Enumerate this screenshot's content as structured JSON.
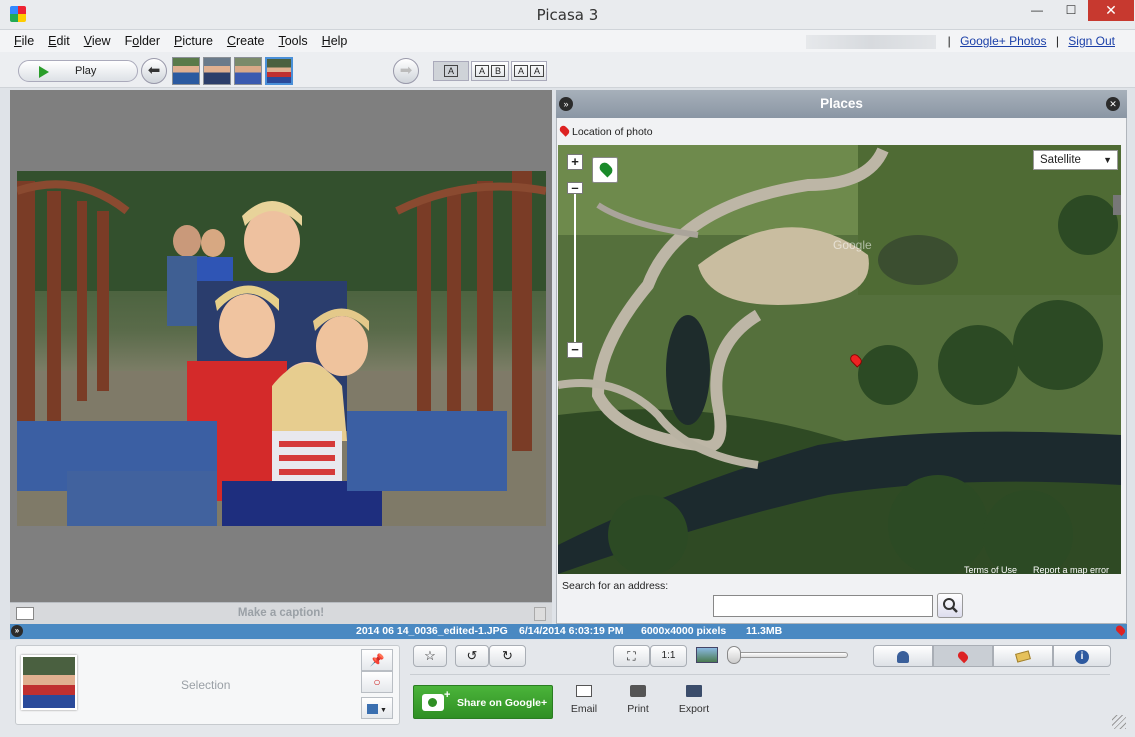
{
  "window": {
    "title": "Picasa 3",
    "min_glyph": "—",
    "max_glyph": "☐",
    "close_glyph": "✕"
  },
  "menu": {
    "items": [
      {
        "pre": "",
        "u": "F",
        "rest": "ile"
      },
      {
        "pre": "",
        "u": "E",
        "rest": "dit"
      },
      {
        "pre": "",
        "u": "V",
        "rest": "iew"
      },
      {
        "pre": "F",
        "u": "o",
        "rest": "lder"
      },
      {
        "pre": "",
        "u": "P",
        "rest": "icture"
      },
      {
        "pre": "",
        "u": "C",
        "rest": "reate"
      },
      {
        "pre": "",
        "u": "T",
        "rest": "ools"
      },
      {
        "pre": "",
        "u": "H",
        "rest": "elp"
      }
    ],
    "separator": "|",
    "google_photos": "Google+ Photos",
    "sign_out": "Sign Out"
  },
  "toolbar": {
    "play_label": "Play",
    "back_glyph": "⬅",
    "forward_glyph": "➡",
    "layout": {
      "single": "A",
      "side_by_side": [
        "A",
        "B"
      ],
      "compare": [
        "A",
        "A"
      ]
    }
  },
  "viewer": {
    "caption_placeholder": "Make a caption!"
  },
  "places": {
    "title": "Places",
    "location_label": "Location of photo",
    "map_type": "Satellite",
    "zoom_in": "+",
    "zoom_out": "−",
    "map_footer": [
      "Terms of Use",
      "Report a map error"
    ],
    "watermark": "Google",
    "search_label": "Search for an address:",
    "search_value": ""
  },
  "info": {
    "filename": "2014 06 14_0036_edited-1.JPG",
    "datetime": "6/14/2014 6:03:19 PM",
    "dimensions": "6000x4000 pixels",
    "filesize": "11.3MB"
  },
  "tray": {
    "label": "Selection"
  },
  "actions": {
    "share": "Share on Google+",
    "email": "Email",
    "print": "Print",
    "export": "Export",
    "zoom_fit": "⛶",
    "zoom_actual": "1:1",
    "rotate_left": "↺",
    "rotate_right": "↻",
    "star": "☆"
  },
  "colors": {
    "accent": "#4a89c2",
    "share_green": "#3aa52e",
    "close_red": "#c7392f"
  }
}
